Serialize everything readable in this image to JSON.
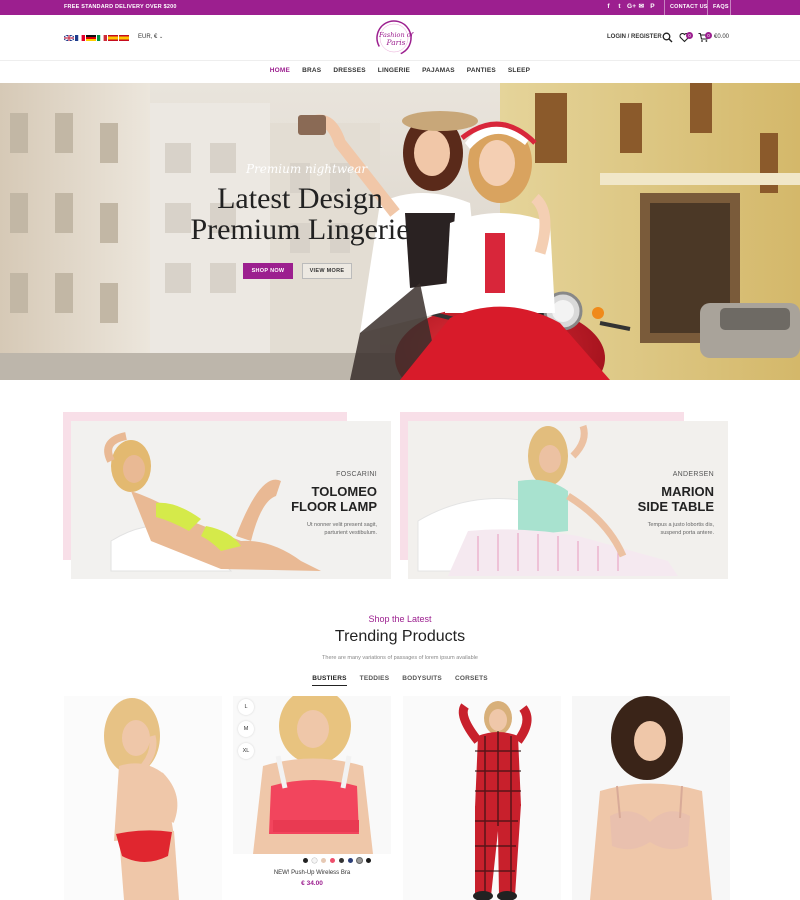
{
  "topbar": {
    "shipping": "FREE STANDARD DELIVERY OVER $200",
    "social_icons": [
      "facebook-icon",
      "twitter-icon",
      "google-plus-icon",
      "email-icon",
      "pinterest-icon"
    ],
    "social_glyphs": [
      "f",
      "t",
      "G+",
      "✉",
      "P"
    ],
    "contact": "CONTACT US",
    "faqs": "FAQS"
  },
  "header": {
    "flags": [
      "uk-flag",
      "france-flag",
      "germany-flag",
      "italy-flag",
      "spain-flag",
      "spain-flag"
    ],
    "currency": "EUR, €",
    "account": "LOGIN / REGISTER",
    "wishlist_count": "0",
    "cart_count": "0",
    "cart_total": "€0.00"
  },
  "nav": {
    "items": [
      "HOME",
      "BRAS",
      "DRESSES",
      "LINGERIE",
      "PAJAMAS",
      "PANTIES",
      "SLEEP"
    ],
    "active": "HOME"
  },
  "hero": {
    "kicker": "Premium nightwear",
    "headline_line1": "Latest Design",
    "headline_line2": "Premium Lingerie",
    "shop_now": "SHOP NOW",
    "view_more": "VIEW MORE"
  },
  "promos": [
    {
      "brand": "FOSCARINI",
      "title_line1": "TOLOMEO",
      "title_line2": "FLOOR LAMP",
      "desc_line1": "Ut nonner velit present sagit,",
      "desc_line2": "parturient vestibulum."
    },
    {
      "brand": "ANDERSEN",
      "title_line1": "MARION",
      "title_line2": "SIDE TABLE",
      "desc_line1": "Tempus a justo lobortis dis,",
      "desc_line2": "suspend porta antere."
    }
  ],
  "trending": {
    "kicker": "Shop the Latest",
    "title": "Trending Products",
    "subtitle": "There are many variations of passages of lorem ipsum available",
    "tabs": [
      "BUSTIERS",
      "TEDDIES",
      "BODYSUITS",
      "CORSETS"
    ],
    "active_tab": "BUSTIERS"
  },
  "product": {
    "sizes": [
      "L",
      "M",
      "XL"
    ],
    "swatch_colors": [
      "#222222",
      "#f5f5f5",
      "#e6c9b4",
      "#ee4f6c",
      "#333333",
      "#2c3e76",
      "#999999",
      "#1b1b1b"
    ],
    "name": "NEW! Push-Up Wireless Bra",
    "price": "€ 34.00"
  },
  "colors": {
    "brand": "#9c1f8f",
    "promo_pink": "#f8dfe8"
  }
}
